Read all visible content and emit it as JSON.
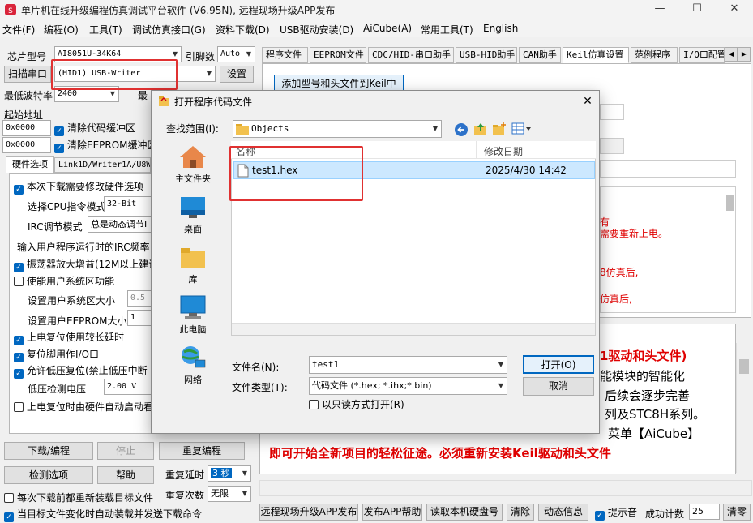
{
  "window": {
    "title": "单片机在线升级编程仿真调试平台软件 (V6.95N), 远程现场升级APP发布",
    "minimize": "—",
    "maximize": "☐",
    "close": "✕"
  },
  "menu": [
    "文件(F)",
    "编程(O)",
    "工具(T)",
    "调试仿真接口(G)",
    "资料下载(D)",
    "USB驱动安装(D)",
    "AiCube(A)",
    "常用工具(T)",
    "English"
  ],
  "left": {
    "chip_label": "芯片型号",
    "chip_value": "AI8051U-34K64",
    "pin_label": "引脚数",
    "pin_value": "Auto",
    "scan_label": "扫描串口",
    "port_value": "(HID1) USB-Writer",
    "settings_button": "设置",
    "baud_label": "最低波特率",
    "baud_value": "2400",
    "baud_max_label": "最",
    "start_addr_label": "起始地址",
    "addr1": "0x0000",
    "clear_code": "清除代码缓冲区",
    "addr2": "0x0000",
    "clear_eeprom": "清除EEPROM缓冲区",
    "subtabs": [
      "硬件选项",
      "Link1D/Writer1A/U8W"
    ],
    "opt_modify": "本次下载需要修改硬件选项",
    "cpu_mode_label": "选择CPU指令模式",
    "cpu_mode_value": "32-Bit",
    "irc_label": "IRC调节模式",
    "irc_value": "总是动态调节I",
    "irc_freq_label": "输入用户程序运行时的IRC频率",
    "osc_gain": "振荡器放大增益(12M以上建议",
    "user_sys": "使能用户系统区功能",
    "sys_size_label": "设置用户系统区大小",
    "sys_size_value": "0.5",
    "eeprom_size_label": "设置用户EEPROM大小",
    "eeprom_size_value": "1",
    "power_reset": "上电复位使用较长延时",
    "reset_io": "复位脚用作I/O口",
    "lvd_reset": "允许低压复位(禁止低压中断",
    "lvd_voltage_label": "低压检测电压",
    "lvd_voltage_value": "2.00 V",
    "hw_auto": "上电复位时由硬件自动启动看",
    "download_button": "下载/编程",
    "stop_button": "停止",
    "reprogram_button": "重复编程",
    "detect_button": "检测选项",
    "help_button": "帮助",
    "repeat_delay_label": "重复延时",
    "repeat_delay_value": "3 秒",
    "repeat_count_label": "重复次数",
    "repeat_count_value": "无限",
    "reload_each": "每次下载前都重新装载目标文件",
    "auto_reload": "当目标文件变化时自动装载并发送下载命令"
  },
  "right": {
    "tabs": [
      "程序文件",
      "EEPROM文件",
      "CDC/HID-串口助手",
      "USB-HID助手",
      "CAN助手",
      "Keil仿真设置",
      "范例程序",
      "I/O口配置"
    ],
    "add_keil_button": "添加型号和头文件到Keil中",
    "notes": [
      "有",
      "需要重新上电。",
      "8仿真后,",
      "仿真后,"
    ],
    "big_text": [
      "1驱动和头文件)",
      "能模块的智能化",
      "后续会逐步完善",
      "列及STC8H系列。",
      "菜单【AiCube】",
      "即可开始全新项目的轻松征途。必须重新安装Keil驱动和头文件"
    ],
    "bottom_buttons": [
      "远程现场升级APP发布",
      "发布APP帮助",
      "读取本机硬盘号",
      "清除",
      "动态信息"
    ],
    "hint_check": "提示音",
    "success_label": "成功计数",
    "success_value": "25",
    "clear_count_button": "清零"
  },
  "dialog": {
    "title": "打开程序代码文件",
    "close": "✕",
    "lookin_label": "查找范围(I):",
    "lookin_value": "Objects",
    "places": [
      "主文件夹",
      "桌面",
      "库",
      "此电脑",
      "网络"
    ],
    "col_name": "名称",
    "col_date": "修改日期",
    "file_name": "test1.hex",
    "file_date": "2025/4/30 14:42",
    "filename_label": "文件名(N):",
    "filename_value": "test1",
    "filetype_label": "文件类型(T):",
    "filetype_value": "代码文件 (*.hex; *.ihx;*.bin)",
    "readonly": "以只读方式打开(R)",
    "open_button": "打开(O)",
    "cancel_button": "取消"
  },
  "colors": {
    "accent": "#0067c0",
    "highlight": "#e03131",
    "red_text": "#e00000",
    "blue_text": "#1a3ec8",
    "folder": "#f2c14e"
  }
}
